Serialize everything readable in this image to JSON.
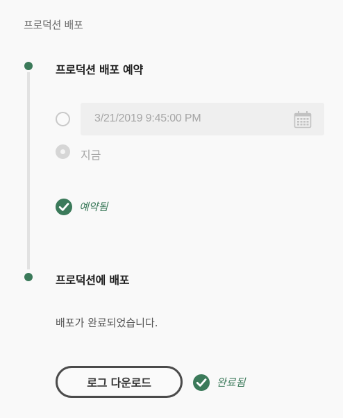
{
  "page": {
    "title": "프로덕션 배포"
  },
  "step1": {
    "title": "프로덕션 배포 예약",
    "schedule_option": {
      "date_value": "3/21/2019  9:45:00 PM",
      "selected": false
    },
    "now_option": {
      "label": "지금",
      "selected": true
    },
    "status": {
      "label": "예약됨",
      "icon": "check-circle-icon"
    }
  },
  "step2": {
    "title": "프로덕션에 배포",
    "message": "배포가 완료되었습니다.",
    "log_button": {
      "label": "로그 다운로드"
    },
    "status": {
      "label": "완료됨",
      "icon": "check-circle-icon"
    }
  },
  "colors": {
    "accent": "#3b7a5a",
    "timeline": "#e2e2e2",
    "field_bg": "#efefef"
  }
}
